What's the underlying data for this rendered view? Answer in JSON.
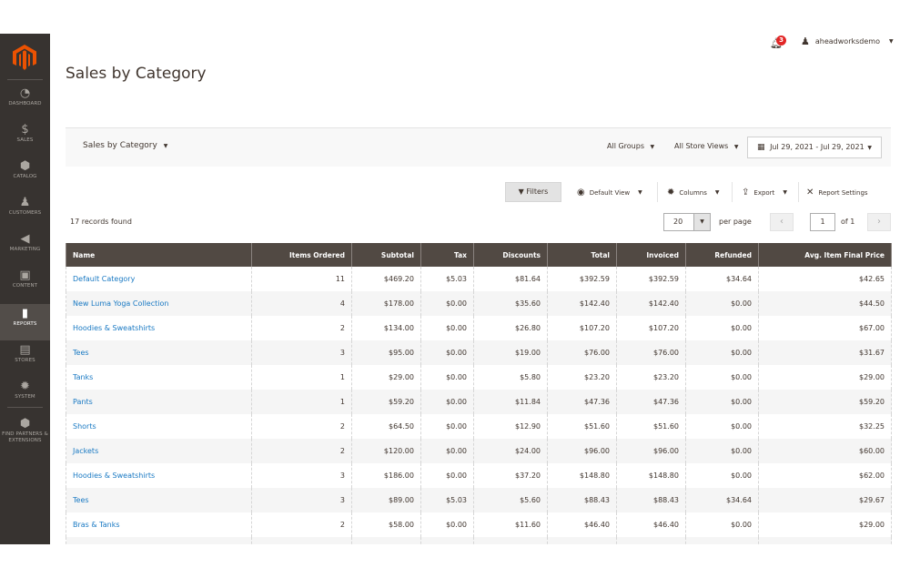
{
  "sidebar": {
    "logo": "magento-logo",
    "items": [
      {
        "label": "Dashboard",
        "icon": "dashboard-icon",
        "glyph": "◔"
      },
      {
        "label": "Sales",
        "icon": "dollar-icon",
        "glyph": "$"
      },
      {
        "label": "Catalog",
        "icon": "box-icon",
        "glyph": "⬢"
      },
      {
        "label": "Customers",
        "icon": "person-icon",
        "glyph": "♟"
      },
      {
        "label": "Marketing",
        "icon": "megaphone-icon",
        "glyph": "◀"
      },
      {
        "label": "Content",
        "icon": "content-icon",
        "glyph": "▣"
      },
      {
        "label": "Reports",
        "icon": "bar-chart-icon",
        "glyph": "▮"
      },
      {
        "label": "Stores",
        "icon": "store-icon",
        "glyph": "▤"
      },
      {
        "label": "System",
        "icon": "gear-icon",
        "glyph": "✹"
      },
      {
        "label": "Find Partners & Extensions",
        "icon": "extensions-icon",
        "glyph": "⬢"
      }
    ],
    "active": "Reports"
  },
  "header": {
    "title": "Sales by Category",
    "notifications_count": "3",
    "user_name": "aheadworksdemo",
    "accent_color": "#eb5202"
  },
  "scope": {
    "report_switch": "Sales by Category",
    "groups": "All Groups",
    "store_views": "All Store Views",
    "date_range": "Jul 29, 2021 - Jul 29, 2021"
  },
  "toolbar": {
    "filters": "Filters",
    "default_view": "Default View",
    "columns": "Columns",
    "export": "Export",
    "report_settings": "Report Settings"
  },
  "pager": {
    "records_found": "17 records found",
    "per_page_value": "20",
    "per_page_label": "per page",
    "current_page": "1",
    "of_pages": "of 1"
  },
  "table": {
    "headers": [
      "Name",
      "Items Ordered",
      "Subtotal",
      "Tax",
      "Discounts",
      "Total",
      "Invoiced",
      "Refunded",
      "Avg. Item Final Price"
    ],
    "rows": [
      [
        "Default Category",
        "11",
        "$469.20",
        "$5.03",
        "$81.64",
        "$392.59",
        "$392.59",
        "$34.64",
        "$42.65"
      ],
      [
        "New Luma Yoga Collection",
        "4",
        "$178.00",
        "$0.00",
        "$35.60",
        "$142.40",
        "$142.40",
        "$0.00",
        "$44.50"
      ],
      [
        "Hoodies & Sweatshirts",
        "2",
        "$134.00",
        "$0.00",
        "$26.80",
        "$107.20",
        "$107.20",
        "$0.00",
        "$67.00"
      ],
      [
        "Tees",
        "3",
        "$95.00",
        "$0.00",
        "$19.00",
        "$76.00",
        "$76.00",
        "$0.00",
        "$31.67"
      ],
      [
        "Tanks",
        "1",
        "$29.00",
        "$0.00",
        "$5.80",
        "$23.20",
        "$23.20",
        "$0.00",
        "$29.00"
      ],
      [
        "Pants",
        "1",
        "$59.20",
        "$0.00",
        "$11.84",
        "$47.36",
        "$47.36",
        "$0.00",
        "$59.20"
      ],
      [
        "Shorts",
        "2",
        "$64.50",
        "$0.00",
        "$12.90",
        "$51.60",
        "$51.60",
        "$0.00",
        "$32.25"
      ],
      [
        "Jackets",
        "2",
        "$120.00",
        "$0.00",
        "$24.00",
        "$96.00",
        "$96.00",
        "$0.00",
        "$60.00"
      ],
      [
        "Hoodies & Sweatshirts",
        "3",
        "$186.00",
        "$0.00",
        "$37.20",
        "$148.80",
        "$148.80",
        "$0.00",
        "$62.00"
      ],
      [
        "Tees",
        "3",
        "$89.00",
        "$5.03",
        "$5.60",
        "$88.43",
        "$88.43",
        "$34.64",
        "$29.67"
      ],
      [
        "Bras & Tanks",
        "2",
        "$58.00",
        "$0.00",
        "$11.60",
        "$46.40",
        "$46.40",
        "$0.00",
        "$29.00"
      ],
      [
        "",
        "",
        "",
        "",
        "",
        "",
        "",
        "",
        ""
      ]
    ]
  }
}
